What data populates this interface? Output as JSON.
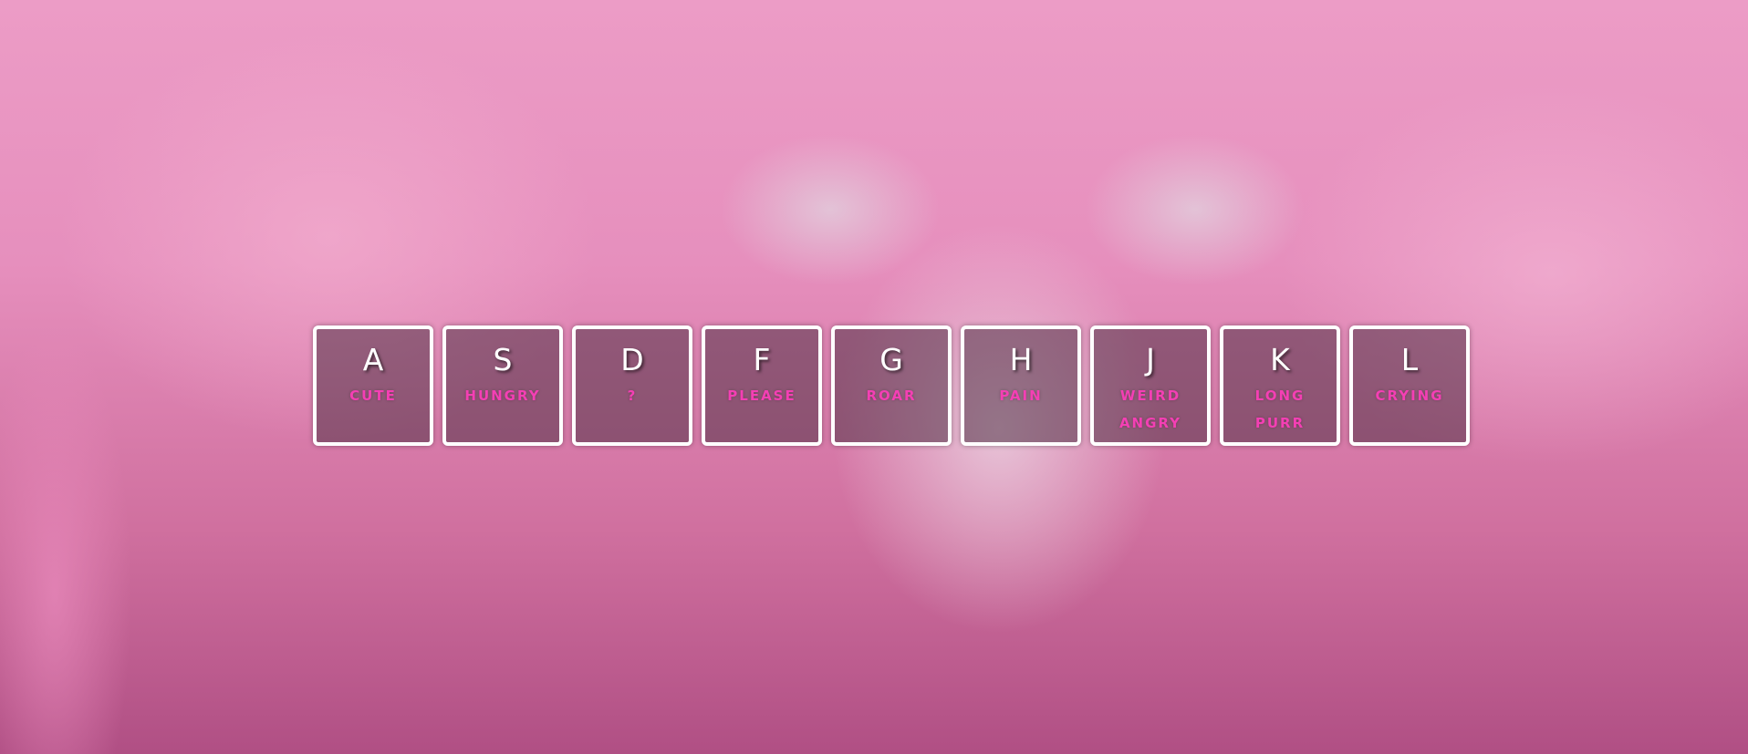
{
  "drum_kit": {
    "keys": [
      {
        "key": "A",
        "label": "CUTE"
      },
      {
        "key": "S",
        "label": "HUNGRY"
      },
      {
        "key": "D",
        "label": "?"
      },
      {
        "key": "F",
        "label": "PLEASE"
      },
      {
        "key": "G",
        "label": "ROAR"
      },
      {
        "key": "H",
        "label": "PAIN"
      },
      {
        "key": "J",
        "label": "WEIRD ANGRY"
      },
      {
        "key": "K",
        "label": "LONG PURR"
      },
      {
        "key": "L",
        "label": "CRYING"
      }
    ]
  },
  "colors": {
    "key_border": "#ffffff",
    "key_letter": "#ffffff",
    "key_label": "#f43fb4"
  }
}
